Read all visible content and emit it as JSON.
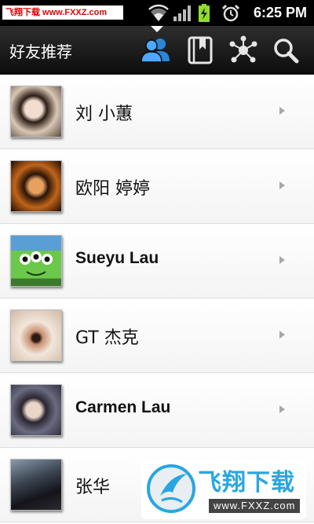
{
  "status_bar": {
    "watermark": "飞翔下载 www.FXXZ.com",
    "time": "6:25 PM",
    "icons": [
      "wifi-icon",
      "signal-icon",
      "battery-charging-icon",
      "alarm-icon"
    ]
  },
  "action_bar": {
    "title": "好友推荐",
    "buttons": [
      {
        "name": "friends-icon",
        "active": true
      },
      {
        "name": "bookmark-book-icon",
        "active": false
      },
      {
        "name": "network-nodes-icon",
        "active": false
      },
      {
        "name": "search-icon",
        "active": false
      }
    ]
  },
  "friends": [
    {
      "name": "刘 小蕙",
      "bold": false,
      "avatar_colors": [
        "#e8d8c8",
        "#3a2a22"
      ]
    },
    {
      "name": "欧阳 婷婷",
      "bold": false,
      "avatar_colors": [
        "#c8781e",
        "#2a1408"
      ]
    },
    {
      "name": "Sueyu Lau",
      "bold": true,
      "avatar_colors": [
        "#5aa0d8",
        "#6ed04a"
      ]
    },
    {
      "name": "GT 杰克",
      "bold": false,
      "avatar_colors": [
        "#f0e4d8",
        "#b08060"
      ]
    },
    {
      "name": "Carmen Lau",
      "bold": true,
      "avatar_colors": [
        "#e0ccc0",
        "#3a3a5a"
      ]
    },
    {
      "name": "张华",
      "bold": false,
      "avatar_colors": [
        "#6a7a8a",
        "#1a1a22"
      ]
    }
  ],
  "watermark_bottom": {
    "text": "飞翔下载",
    "url": "www.FXXZ.com"
  }
}
